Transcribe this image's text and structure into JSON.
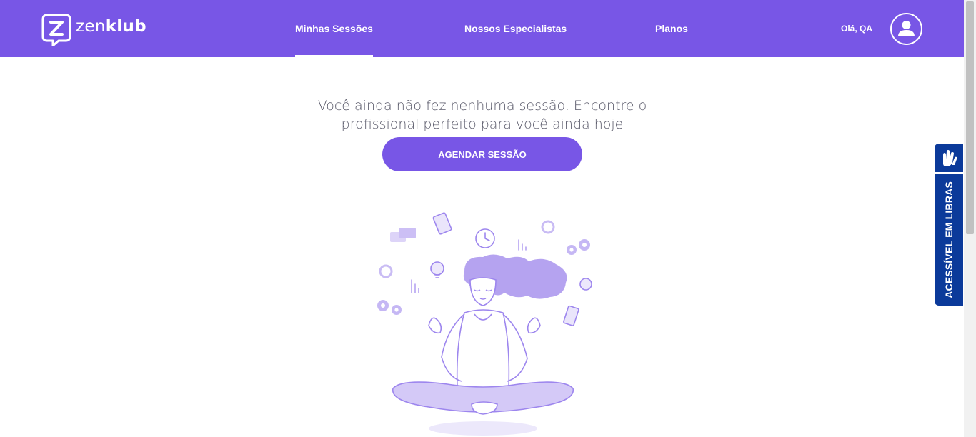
{
  "brand": {
    "name_light": "zen",
    "name_bold": "klub",
    "accent": "#7856e6"
  },
  "nav": {
    "items": [
      {
        "label": "Minhas Sessões",
        "active": true
      },
      {
        "label": "Nossos Especialistas",
        "active": false
      },
      {
        "label": "Planos",
        "active": false
      }
    ]
  },
  "user": {
    "greeting": "Olá, QA",
    "avatar_icon": "user-icon"
  },
  "main": {
    "message": "Você ainda não fez nenhuma sessão. Encontre o profissional perfeito para você ainda hoje",
    "cta_label": "AGENDAR SESSÃO",
    "illustration_icon": "meditating-woman-illustration"
  },
  "libras": {
    "label": "ACESSÍVEL EM LIBRAS",
    "icon": "sign-language-hands-icon",
    "color": "#0b3a9a"
  }
}
